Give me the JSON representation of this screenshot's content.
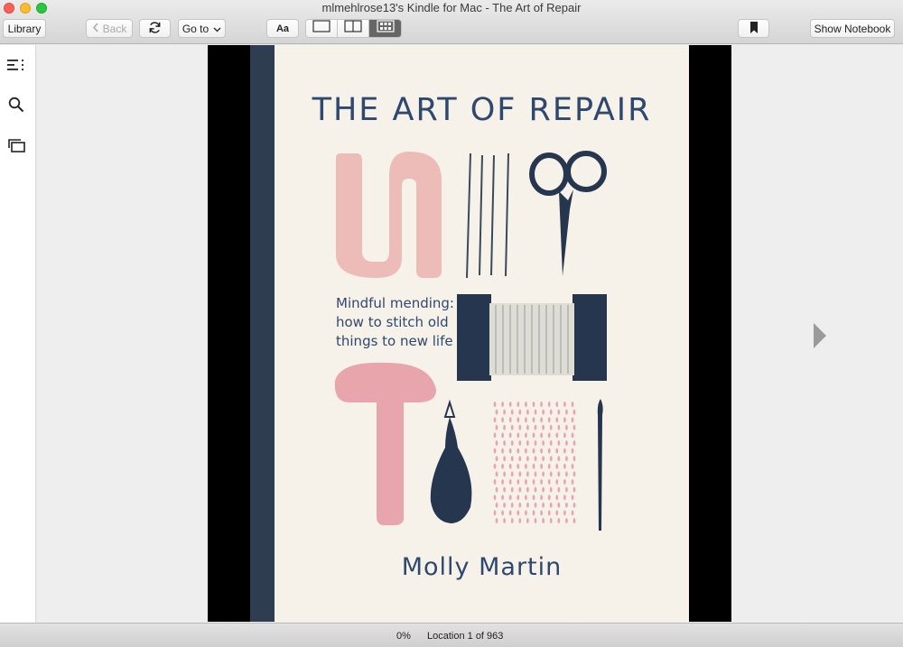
{
  "window": {
    "title": "mlmehlrose13's Kindle for Mac - The Art of Repair"
  },
  "toolbar": {
    "library_label": "Library",
    "back_label": "Back",
    "goto_label": "Go to",
    "font_label": "Aa",
    "show_notebook_label": "Show Notebook",
    "view_modes": [
      "single-page-icon",
      "two-page-icon",
      "grid-view-icon"
    ],
    "active_view_mode": "grid-view-icon"
  },
  "sidebar": {
    "icons": [
      "table-of-contents-icon",
      "search-icon",
      "flashcards-icon"
    ]
  },
  "book_cover": {
    "title": "THE ART OF REPAIR",
    "subtitle_lines": [
      "Mindful mending:",
      "how to stitch old",
      "things to new life"
    ],
    "author": "Molly Martin"
  },
  "status": {
    "progress": "0%",
    "location": "Location 1 of 963"
  },
  "colors": {
    "navy": "#2f4870",
    "pink": "#e8a5ab",
    "cream": "#f6f2e9",
    "spine": "#2e3d50"
  }
}
